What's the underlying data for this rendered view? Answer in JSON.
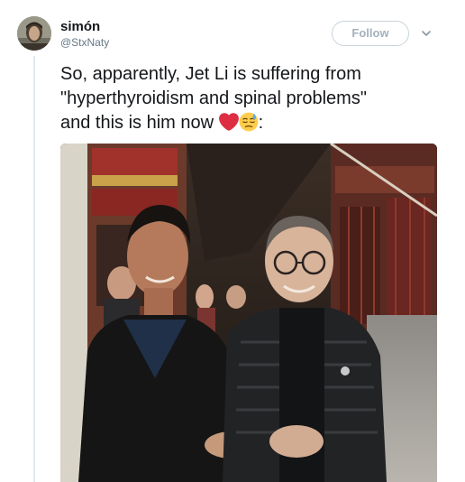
{
  "user": {
    "name": "simón",
    "handle": "@StxNaty"
  },
  "actions": {
    "follow_label": "Follow",
    "menu_icon": "chevron-down-icon"
  },
  "tweet": {
    "line1": "So, apparently, Jet Li is suffering from",
    "line2": "\"hyperthyroidism and spinal problems\"",
    "line3": "and this is him now",
    "line3_suffix": ":",
    "emojis": [
      "red-heart-emoji",
      "downcast-face-with-sweat-emoji"
    ]
  },
  "media": {
    "type": "photo"
  },
  "colors": {
    "name": "#14171a",
    "handle": "#657786",
    "follow_border": "#c9d3db",
    "follow_text": "#a3b1bd",
    "thread_line": "#e1e8ed",
    "heart": "#dd2e44"
  }
}
